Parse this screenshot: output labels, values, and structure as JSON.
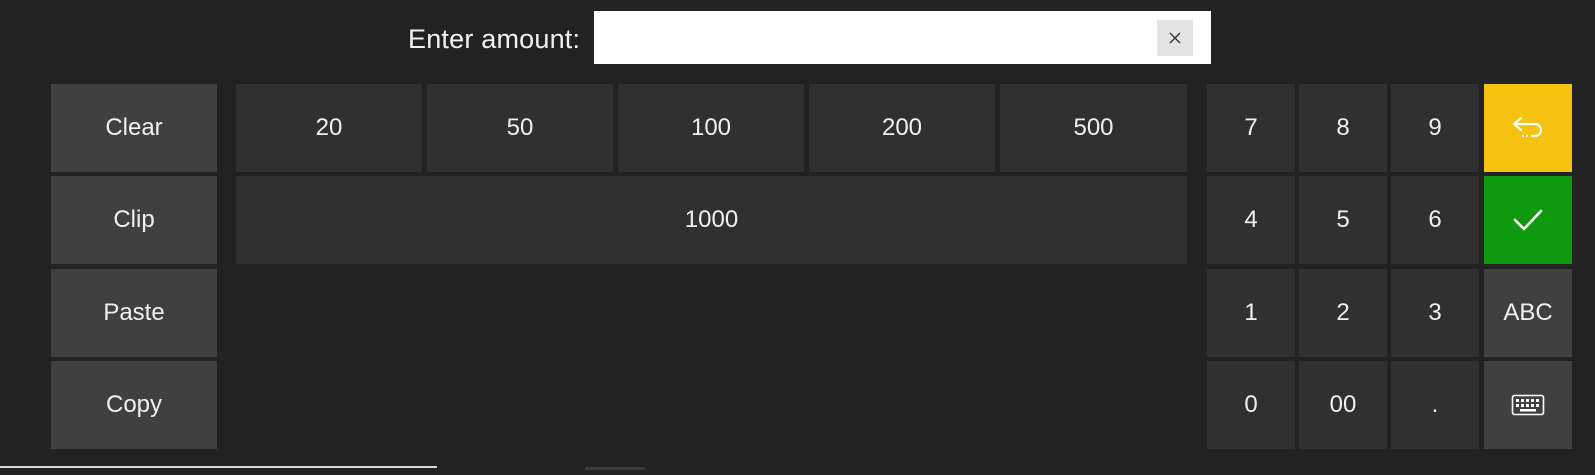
{
  "prompt": {
    "label": "Enter amount:",
    "value": "",
    "placeholder": ""
  },
  "side_buttons": [
    "Clear",
    "Clip",
    "Paste",
    "Copy"
  ],
  "quick_amounts": [
    "20",
    "50",
    "100",
    "200",
    "500"
  ],
  "quick_amount_wide": "1000",
  "numpad": {
    "row1": [
      "7",
      "8",
      "9"
    ],
    "row2": [
      "4",
      "5",
      "6"
    ],
    "row3": [
      "1",
      "2",
      "3"
    ],
    "row4": [
      "0",
      "00",
      "."
    ]
  },
  "function_keys": {
    "back_icon": "return-arrow-icon",
    "confirm_icon": "checkmark-icon",
    "abc_label": "ABC",
    "keyboard_icon": "keyboard-icon"
  },
  "colors": {
    "background": "#222222",
    "back_key": "#f5c211",
    "confirm_key": "#109a10",
    "side_key": "#404040",
    "num_key": "#303030"
  }
}
